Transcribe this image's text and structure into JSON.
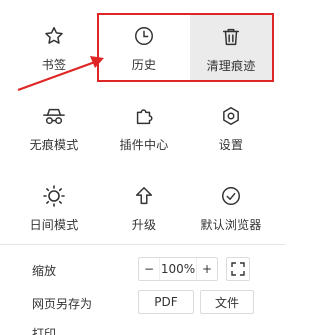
{
  "menu": {
    "row1": [
      {
        "label": "书签",
        "icon": "star-icon"
      },
      {
        "label": "历史",
        "icon": "clock-icon"
      },
      {
        "label": "清理痕迹",
        "icon": "trash-icon"
      }
    ],
    "row2": [
      {
        "label": "无痕模式",
        "icon": "incognito-icon"
      },
      {
        "label": "插件中心",
        "icon": "puzzle-icon"
      },
      {
        "label": "设置",
        "icon": "gear-icon"
      }
    ],
    "row3": [
      {
        "label": "日间模式",
        "icon": "sun-icon"
      },
      {
        "label": "升级",
        "icon": "upgrade-arrow-icon"
      },
      {
        "label": "默认浏览器",
        "icon": "check-circle-icon"
      }
    ]
  },
  "zoom": {
    "label": "缩放",
    "minus": "−",
    "value": "100%",
    "plus": "+"
  },
  "save_as": {
    "label": "网页另存为",
    "pdf": "PDF",
    "file": "文件"
  },
  "print": {
    "label": "打印"
  },
  "colors": {
    "highlight_box": "#e02525",
    "hover_bg": "#ebebeb"
  }
}
